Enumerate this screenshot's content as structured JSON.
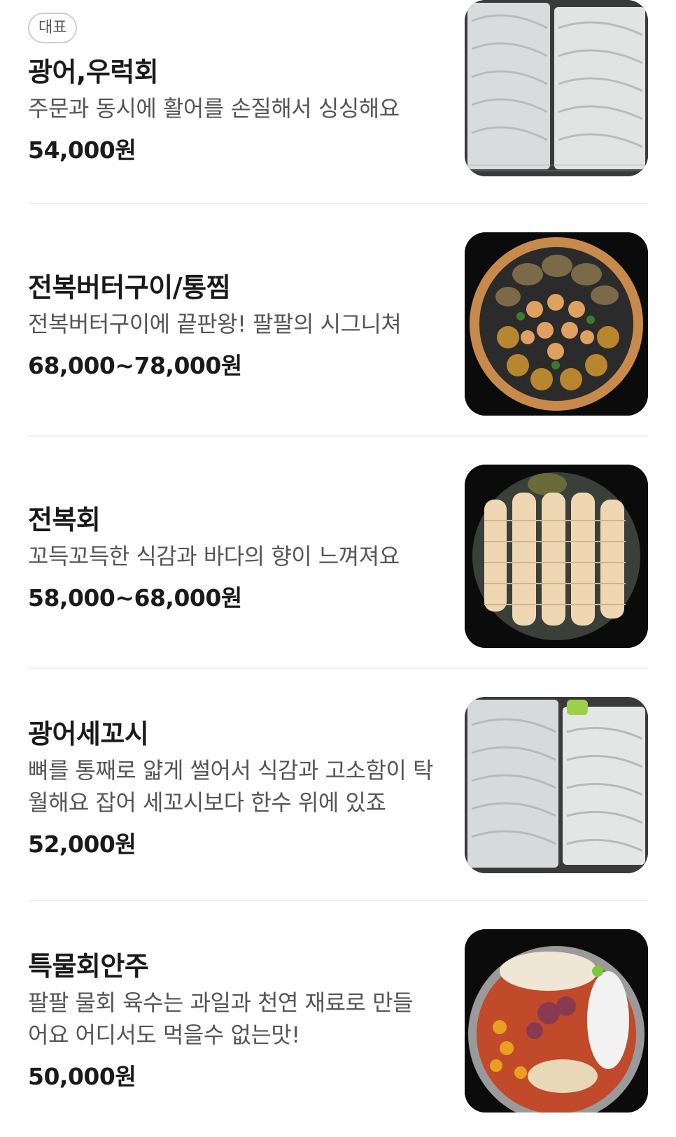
{
  "menu": {
    "items": [
      {
        "badge": "대표",
        "name": "광어,우럭회",
        "description": "주문과 동시에 활어를 손질해서 싱싱해요",
        "price": "54,000원",
        "image": "flounder-sashimi-on-racks"
      },
      {
        "name": "전복버터구이/통찜",
        "description": "전복버터구이에 끝판왕! 팔팔의 시그니쳐",
        "price": "68,000~78,000원",
        "image": "abalone-butter-grill-platter"
      },
      {
        "name": "전복회",
        "description": "꼬득꼬득한 식감과 바다의 향이 느껴져요",
        "price": "58,000~68,000원",
        "image": "abalone-sashimi-platter"
      },
      {
        "name": "광어세꼬시",
        "description": "뼈를 통째로 얇게 썰어서 식감과 고소함이 탁월해요 잡어 세꼬시보다 한수 위에 있죠",
        "price": "52,000원",
        "image": "flounder-sekoshi-on-racks"
      },
      {
        "name": "특물회안주",
        "description": "팔팔 물회 육수는 과일과 천연 재료로 만들어요 어디서도 먹을수 없는맛!",
        "price": "50,000원",
        "image": "mulhoe-bowl"
      }
    ]
  }
}
